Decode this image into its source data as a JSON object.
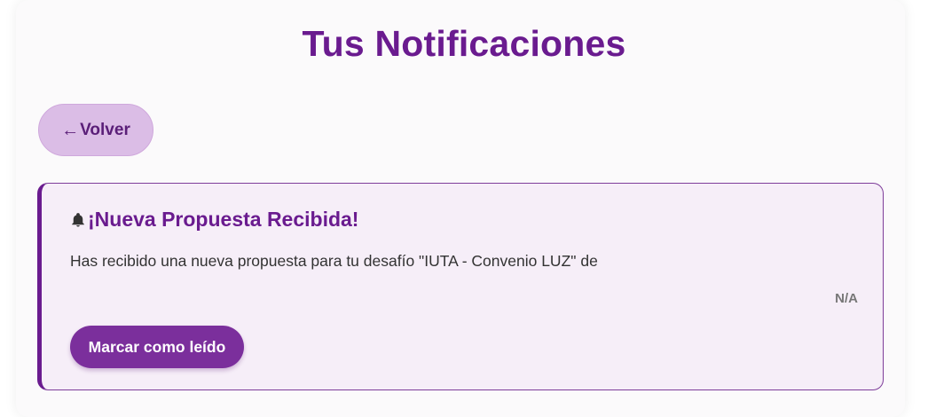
{
  "page": {
    "title": "Tus Notificaciones"
  },
  "back_button": {
    "arrow": "←",
    "label": "Volver"
  },
  "notifications": [
    {
      "icon": "bell-icon",
      "title": "¡Nueva Propuesta Recibida!",
      "message": "Has recibido una nueva propuesta para tu desafío \"IUTA - Convenio LUZ\" de",
      "date": "N/A",
      "action_label": "Marcar como leído"
    }
  ],
  "colors": {
    "brand_purple": "#6a1b8f",
    "button_purple": "#7b2f9c",
    "back_button_bg": "#dbbde6",
    "card_bg": "#f6eef8"
  }
}
